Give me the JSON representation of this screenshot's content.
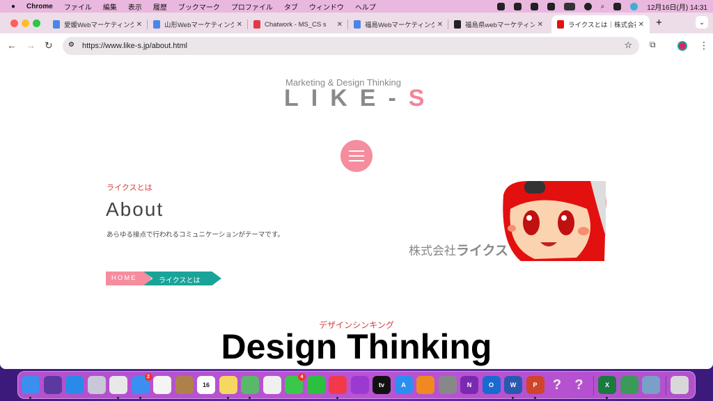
{
  "menubar": {
    "apple": "",
    "app": "Chrome",
    "items": [
      "ファイル",
      "編集",
      "表示",
      "履歴",
      "ブックマーク",
      "プロファイル",
      "タブ",
      "ウィンドウ",
      "ヘルプ"
    ],
    "datetime": "12月16日(月) 14:31"
  },
  "tabs": [
    {
      "title": "愛媛Webマーケティング",
      "favicon": "google-docs-icon",
      "active": false
    },
    {
      "title": "山形Webマーケティング",
      "favicon": "google-docs-icon",
      "active": false
    },
    {
      "title": "Chatwork - MS_CS s",
      "favicon": "chatwork-icon",
      "active": false
    },
    {
      "title": "福島Webマーケティング",
      "favicon": "google-docs-icon",
      "active": false
    },
    {
      "title": "福島県webマーケティング",
      "favicon": "ew-icon",
      "active": false
    },
    {
      "title": "ライクスとは｜株式会社",
      "favicon": "likes-icon",
      "active": true
    }
  ],
  "toolbar": {
    "url": "https://www.like-s.jp/about.html"
  },
  "page": {
    "tagline": "Marketing & Design Thinking",
    "logo": {
      "main": "LIKE-",
      "accent": "S"
    },
    "section_sub": "ライクスとは",
    "section_title": "About",
    "description": "あらゆる接点で行われるコミュニケーションがテーマです。",
    "breadcrumb": [
      "HOME",
      "ライクスとは"
    ],
    "company_prefix": "株式会社",
    "company_name": "ライクス",
    "dt_sub": "デザインシンキング",
    "dt_title": "Design Thinking"
  },
  "colors": {
    "pink": "#f58d9f",
    "teal": "#1aa399",
    "red": "#d43a3a"
  },
  "dock": [
    {
      "name": "finder",
      "color": "#3a8ff0",
      "dot": true
    },
    {
      "name": "siri",
      "color": "#5a3aa0"
    },
    {
      "name": "safari",
      "color": "#2a8ae8"
    },
    {
      "name": "launchpad",
      "color": "#c8c8d8"
    },
    {
      "name": "chrome",
      "color": "#e8e8e8",
      "dot": true
    },
    {
      "name": "mail",
      "color": "#3a8ff0",
      "badge": "2",
      "dot": true
    },
    {
      "name": "reminders",
      "color": "#f4f4f4"
    },
    {
      "name": "contacts",
      "color": "#b0804a"
    },
    {
      "name": "calendar",
      "color": "#ffffff",
      "label": "16"
    },
    {
      "name": "notes",
      "color": "#f6d860",
      "dot": true
    },
    {
      "name": "maps",
      "color": "#5ab86a",
      "dot": true
    },
    {
      "name": "photos",
      "color": "#f0f0f0"
    },
    {
      "name": "messages",
      "color": "#3ac84a",
      "badge": "4"
    },
    {
      "name": "facetime",
      "color": "#2ac040"
    },
    {
      "name": "music",
      "color": "#f03a4a",
      "dot": true
    },
    {
      "name": "podcasts",
      "color": "#9a3ad0"
    },
    {
      "name": "tv",
      "color": "#111111",
      "label": "tv"
    },
    {
      "name": "app-store",
      "color": "#2a8ff0",
      "label": "A"
    },
    {
      "name": "books",
      "color": "#f08a20"
    },
    {
      "name": "system-settings",
      "color": "#888888"
    },
    {
      "name": "onenote",
      "color": "#7a2ab0",
      "label": "N"
    },
    {
      "name": "outlook",
      "color": "#1a6ad0",
      "label": "O"
    },
    {
      "name": "word",
      "color": "#2a5ab0",
      "label": "W",
      "dot": true
    },
    {
      "name": "powerpoint",
      "color": "#d0442a",
      "label": "P",
      "dot": true
    },
    {
      "name": "unknown-app",
      "color": "transparent",
      "label": "?"
    },
    {
      "name": "unknown-app",
      "color": "transparent",
      "label": "?"
    },
    {
      "sep": true
    },
    {
      "name": "excel",
      "color": "#1a7a40",
      "label": "X",
      "dot": true
    },
    {
      "name": "app",
      "color": "#3a9a5a"
    },
    {
      "name": "preview",
      "color": "#7aa0c8"
    },
    {
      "sep": true
    },
    {
      "name": "trash",
      "color": "#d8d8d8"
    }
  ]
}
